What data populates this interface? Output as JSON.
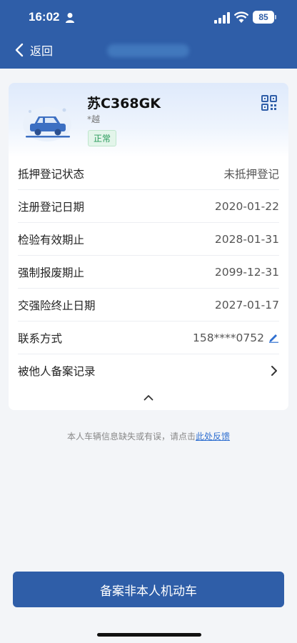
{
  "status_bar": {
    "time": "16:02",
    "battery": "85"
  },
  "nav": {
    "back_label": "返回"
  },
  "vehicle": {
    "plate": "苏C368GK",
    "sub": "*越",
    "status_badge": "正常"
  },
  "rows": [
    {
      "label": "抵押登记状态",
      "value": "未抵押登记"
    },
    {
      "label": "注册登记日期",
      "value": "2020-01-22"
    },
    {
      "label": "检验有效期止",
      "value": "2028-01-31"
    },
    {
      "label": "强制报废期止",
      "value": "2099-12-31"
    },
    {
      "label": "交强险终止日期",
      "value": "2027-01-17"
    },
    {
      "label": "联系方式",
      "value": "158****0752"
    },
    {
      "label": "被他人备案记录",
      "value": ""
    }
  ],
  "feedback": {
    "text": "本人车辆信息缺失或有误，请点击",
    "link": "此处反馈"
  },
  "bottom_button": {
    "label": "备案非本人机动车"
  },
  "colors": {
    "primary": "#2f5ea8",
    "badge_green": "#2a9b5b",
    "link": "#2f6fd0"
  }
}
